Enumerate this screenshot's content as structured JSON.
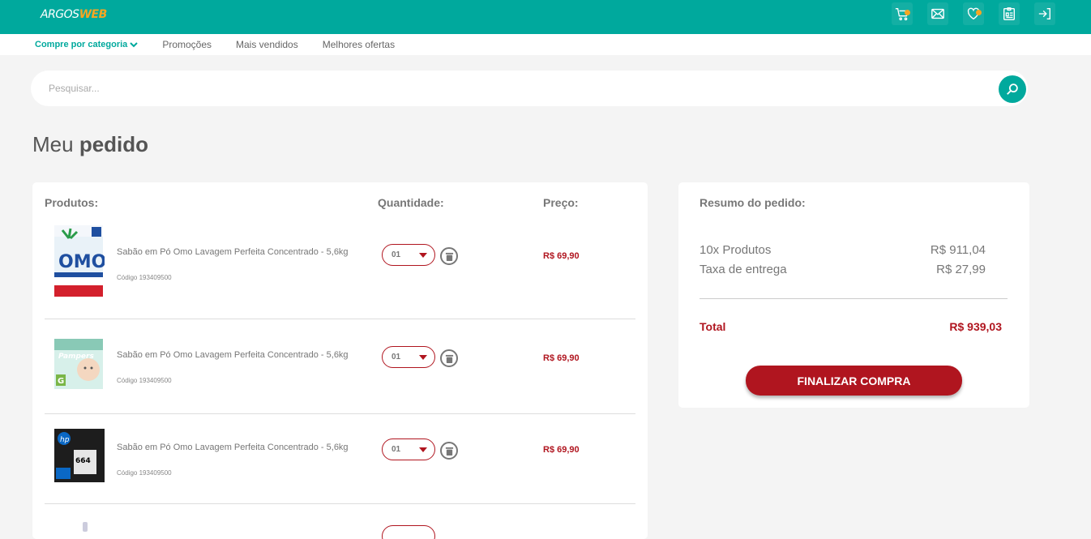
{
  "brand": {
    "part1": "ARGOS",
    "part2": "WEB"
  },
  "header_icons": [
    "cart-icon",
    "mail-icon",
    "favorites-icon",
    "account-icon",
    "login-icon"
  ],
  "nav": {
    "category_label": "Compre por categoria",
    "links": [
      "Promoções",
      "Mais vendidos",
      "Melhores ofertas"
    ]
  },
  "search": {
    "placeholder": "Pesquisar..."
  },
  "page_title": {
    "normal": "Meu",
    "bold": "pedido"
  },
  "products": {
    "headers": {
      "product": "Produtos:",
      "quantity": "Quantidade:",
      "price": "Preço:"
    },
    "items": [
      {
        "name": "Sabão em Pó Omo Lavagem Perfeita Concentrado - 5,6kg",
        "code": "Código 193409500",
        "qty": "01",
        "price": "R$ 69,90",
        "image": "omo-detergent"
      },
      {
        "name": "Sabão em Pó Omo Lavagem Perfeita Concentrado - 5,6kg",
        "code": "Código 193409500",
        "qty": "01",
        "price": "R$ 69,90",
        "image": "pampers-diapers"
      },
      {
        "name": "Sabão em Pó Omo Lavagem Perfeita Concentrado - 5,6kg",
        "code": "Código 193409500",
        "qty": "01",
        "price": "R$ 69,90",
        "image": "hp-ink-cartridge"
      }
    ]
  },
  "summary": {
    "title": "Resumo do pedido:",
    "products_label": "10x Produtos",
    "products_value": "R$ 911,04",
    "shipping_label": "Taxa de entrega",
    "shipping_value": "R$ 27,99",
    "total_label": "Total",
    "total_value": "R$ 939,03",
    "checkout_label": "FINALIZAR COMPRA"
  },
  "colors": {
    "primary": "#00a99d",
    "accent": "#b0151f",
    "brand_accent": "#f5a623"
  }
}
